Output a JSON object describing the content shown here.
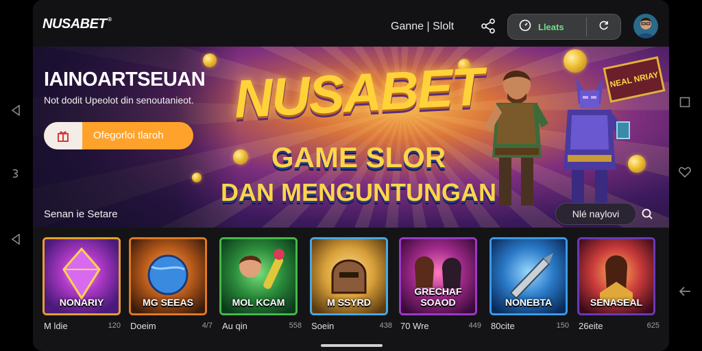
{
  "app": {
    "logo": "NUSABET",
    "logo_reg": "®",
    "nav_link": "Ganne | Slolt",
    "pill_label": "Lleats"
  },
  "hero": {
    "title_white": "IAINOARTSEUAN",
    "subtitle": "Not dodit Upeolot din senoutanieot.",
    "cta_label": "Ofegorloi tlaroh",
    "logo": "NUSABET",
    "line1": "GAME SLOR",
    "line2": "DAN MENGUNTUNGAN",
    "badge": "NEAL NRIAY",
    "section_label": "Senan ie Setare",
    "section_button": "Nlé naylovi"
  },
  "games": [
    {
      "title": "NONARIY",
      "name": "M ldie",
      "num": "120",
      "border": "#e6a02a"
    },
    {
      "title": "MG SEEAS",
      "name": "Doeim",
      "num": "4/7",
      "border": "#e07a22"
    },
    {
      "title": "MOL KCAM",
      "name": "Au qin",
      "num": "558",
      "border": "#46b84a"
    },
    {
      "title": "M SSYRD",
      "name": "Soein",
      "num": "438",
      "border": "#4aa8e0"
    },
    {
      "title": "GRECHAF SOAOD",
      "name": "70 Wre",
      "num": "449",
      "border": "#9a3ac8"
    },
    {
      "title": "NONEBTA",
      "name": "80cite",
      "num": "150",
      "border": "#3a9ae8"
    },
    {
      "title": "SENASEAL",
      "name": "26eite",
      "num": "625",
      "border": "#6a3ab8"
    }
  ],
  "colors": {
    "accent_orange": "#ffa22b",
    "pill_green": "#6fe08a",
    "gold": "#ffd23a"
  }
}
